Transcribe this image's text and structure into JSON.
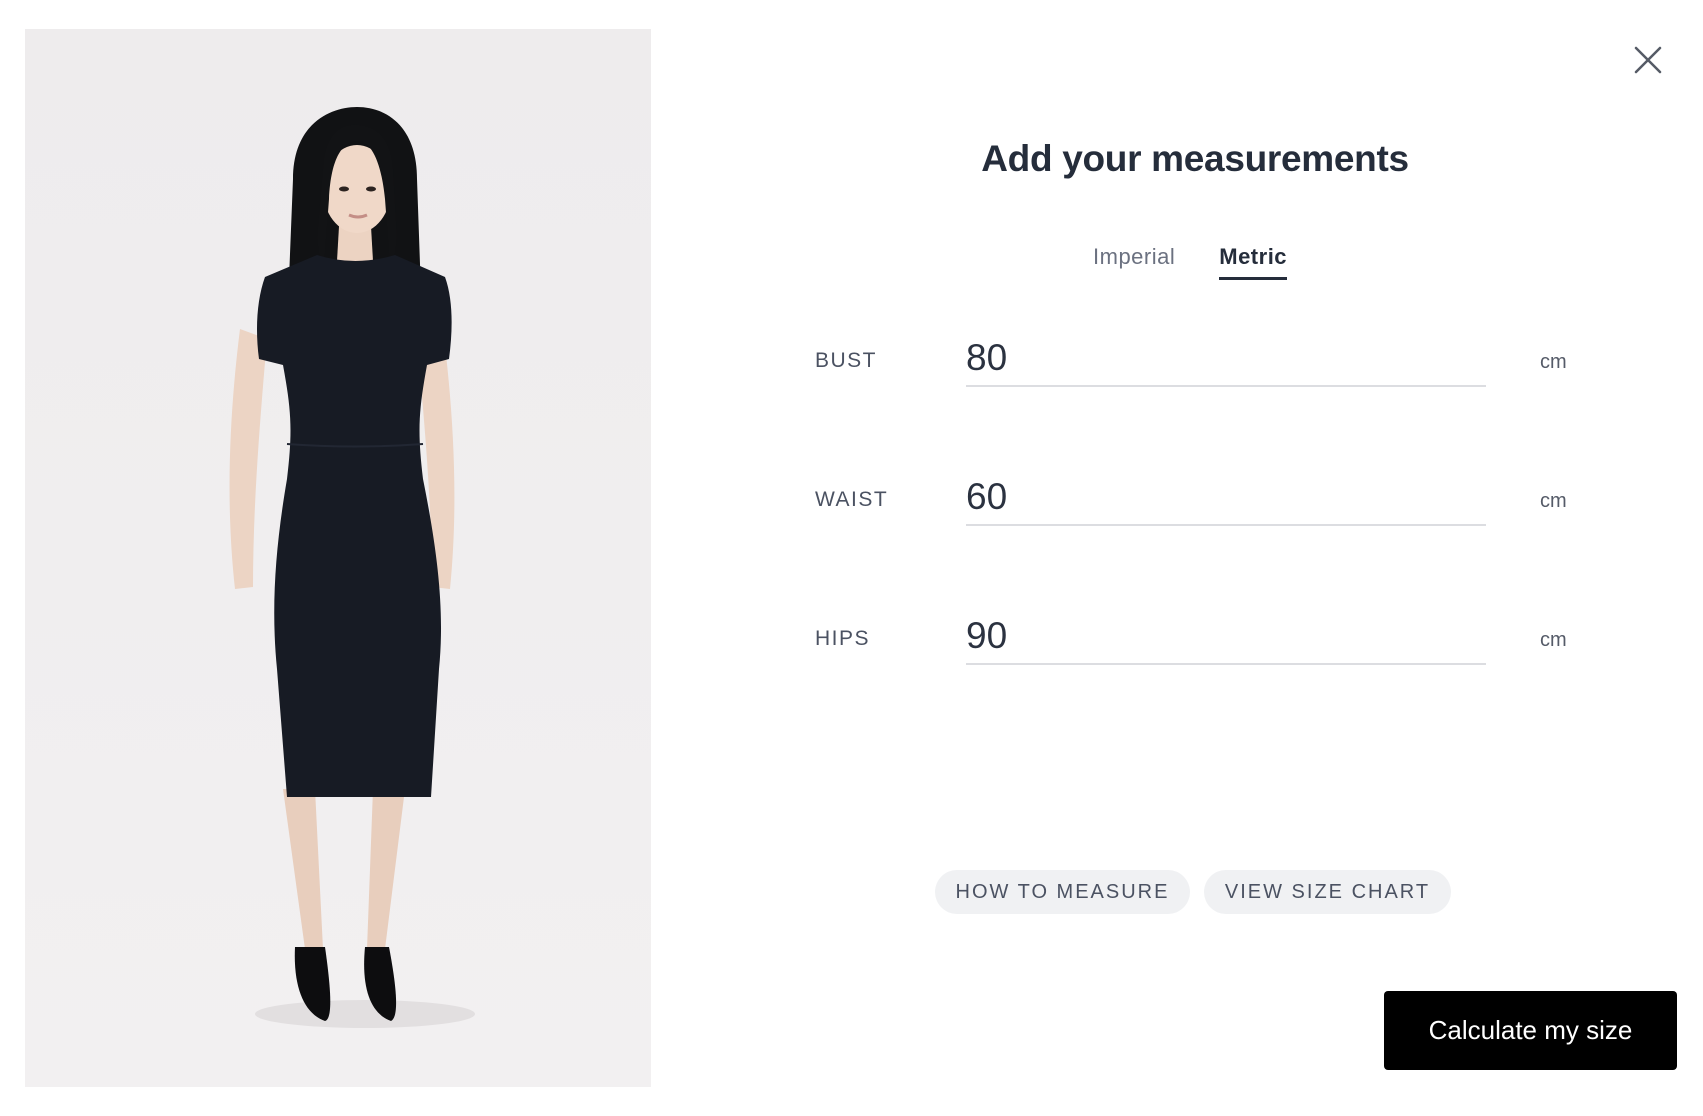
{
  "modal": {
    "title": "Add your measurements",
    "close_icon": "close-icon",
    "product_image_description_icon": "model-photo"
  },
  "tabs": [
    {
      "label": "Imperial",
      "active": false
    },
    {
      "label": "Metric",
      "active": true
    }
  ],
  "fields": {
    "bust": {
      "label": "BUST",
      "value": "80",
      "unit": "cm"
    },
    "waist": {
      "label": "WAIST",
      "value": "60",
      "unit": "cm"
    },
    "hips": {
      "label": "HIPS",
      "value": "90",
      "unit": "cm"
    }
  },
  "links": {
    "how_to_measure": "HOW TO MEASURE",
    "view_size_chart": "VIEW SIZE CHART"
  },
  "cta": {
    "label": "Calculate my size"
  },
  "colors": {
    "accent": "#000000",
    "title_text": "#252d3b",
    "pill_background": "#f0f1f3",
    "dress": "#171b24"
  }
}
